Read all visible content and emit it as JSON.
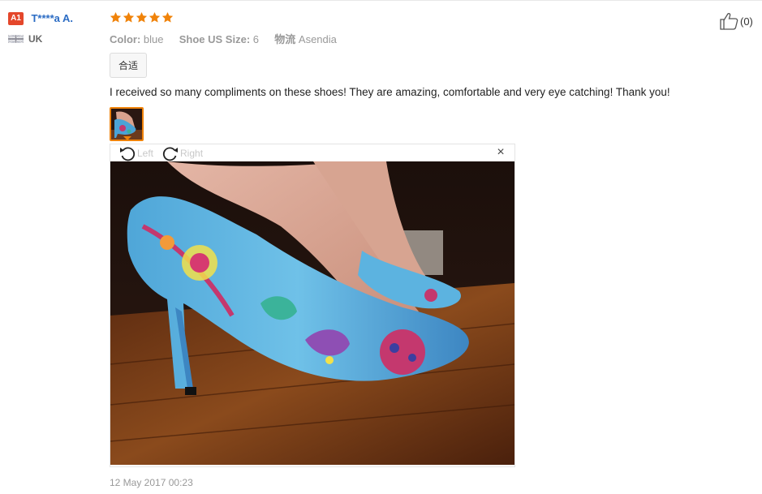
{
  "user": {
    "level": "A1",
    "name": "T****a A.",
    "country": "UK"
  },
  "review": {
    "rating": 5,
    "color_key": "Color:",
    "color_value": "blue",
    "size_key": "Shoe US Size:",
    "size_value": "6",
    "shipping_key": "物流",
    "shipping_value": "Asendia",
    "fit_tag": "合适",
    "text": "I received so many compliments on these shoes! They are amazing, comfortable and very eye catching! Thank you!",
    "date": "12 May 2017 00:23"
  },
  "viewer": {
    "rotate_left": "Left",
    "rotate_right": "Right",
    "close": "×"
  },
  "helpful": {
    "count": "(0)"
  },
  "icons": [
    "uk-flag-icon",
    "star-icon",
    "rotate-left-icon",
    "rotate-right-icon",
    "close-icon",
    "thumbs-up-icon"
  ],
  "colors": {
    "badge": "#e4472b",
    "username": "#2b6cc4",
    "star": "#f0830a",
    "thumb_border": "#f0830a"
  }
}
